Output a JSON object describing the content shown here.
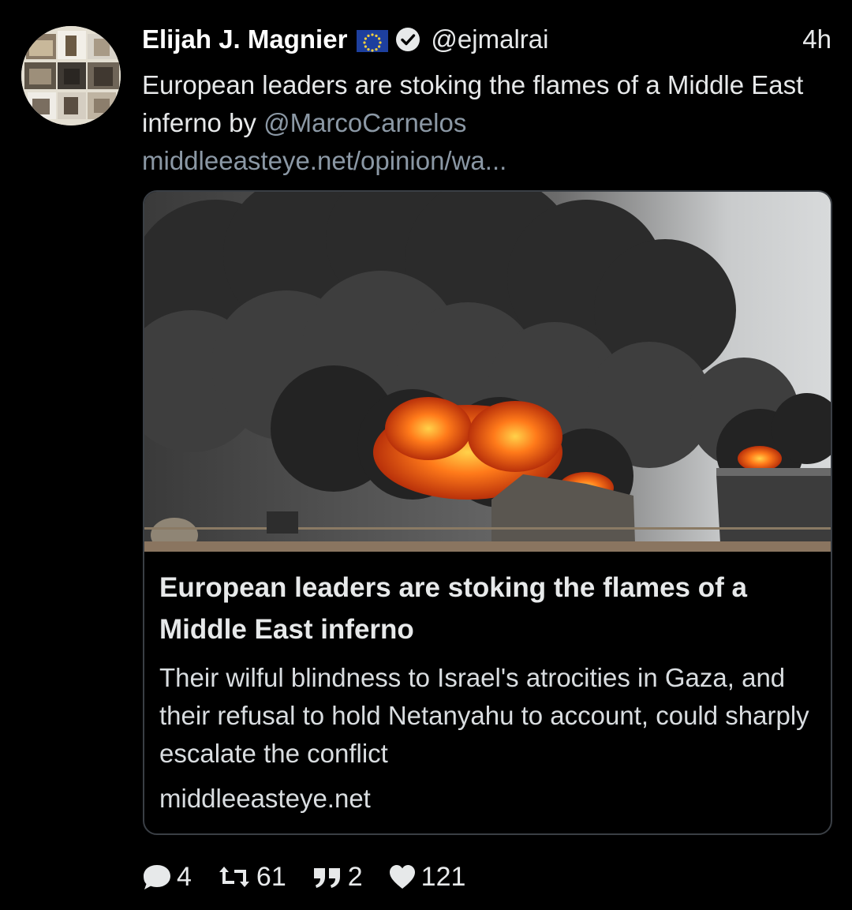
{
  "tweet": {
    "author_name": "Elijah J. Magnier",
    "handle": "@ejmalrai",
    "time": "4h",
    "text_before": "European leaders are stoking the flames of a Middle East inferno by ",
    "mention": "@MarcoCarnelos",
    "link": "middleeasteye.net/opinion/wa..."
  },
  "card": {
    "title": "European leaders are stoking the flames of a Middle East inferno",
    "description": "Their wilful blindness to Israel's atrocities in Gaza, and their refusal to hold Netanyahu to account, could sharply escalate the conflict",
    "domain": "middleeasteye.net"
  },
  "actions": {
    "replies": "4",
    "retweets": "61",
    "quotes": "2",
    "likes": "121"
  },
  "icons": {
    "flag": "eu-flag-icon",
    "verified": "verified-badge-icon",
    "reply": "reply-icon",
    "retweet": "retweet-icon",
    "quote": "quote-icon",
    "like": "heart-icon"
  },
  "colors": {
    "background": "#000000",
    "text": "#e7e9ea",
    "link": "#8b98a5",
    "card_border": "#3a3f45"
  }
}
